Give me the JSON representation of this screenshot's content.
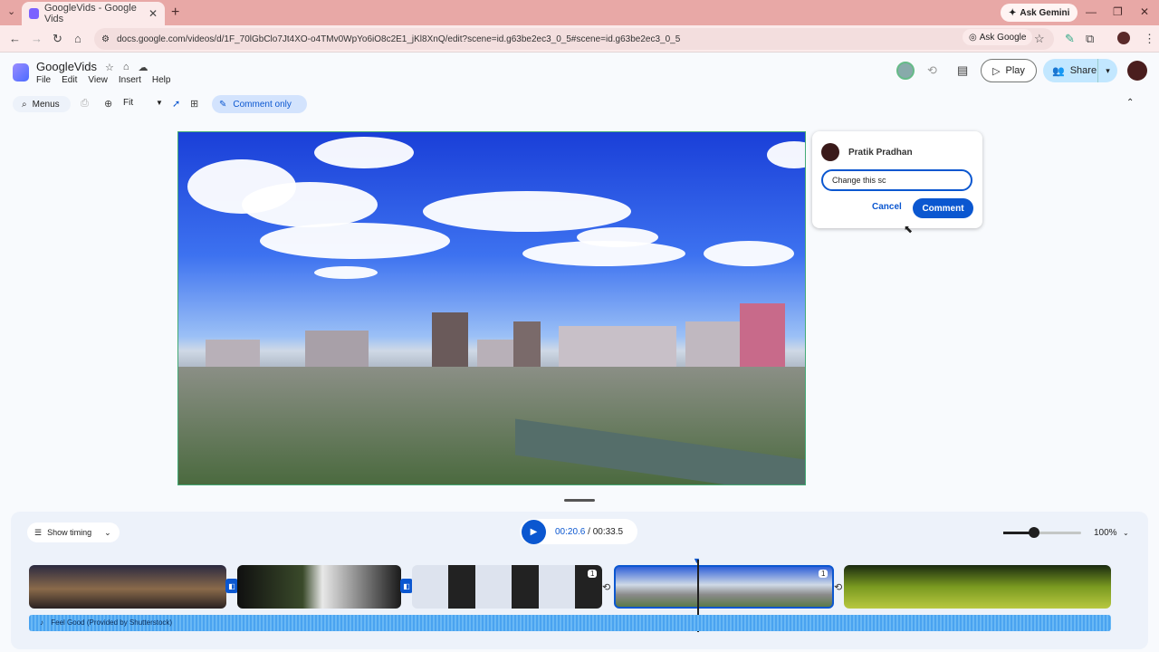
{
  "browser": {
    "tab_title": "GoogleVids - Google Vids",
    "tab_close": "✕",
    "new_tab": "+",
    "ask_gemini": "Ask Gemini",
    "url": "docs.google.com/videos/d/1F_70lGbClo7Jt4XO-o4TMv0WpYo6iO8c2E1_jKl8XnQ/edit?scene=id.g63be2ec3_0_5#scene=id.g63be2ec3_0_5",
    "ask_google": "Ask Google"
  },
  "app": {
    "doc_title": "GoogleVids",
    "menus": [
      "File",
      "Edit",
      "View",
      "Insert",
      "Help"
    ],
    "play_label": "Play",
    "share_label": "Share"
  },
  "toolbar": {
    "menus_label": "Menus",
    "zoom_label": "Fit",
    "mode_label": "Comment only"
  },
  "comment": {
    "author": "Pratik Pradhan",
    "input_value": "Change this sc",
    "cancel_label": "Cancel",
    "submit_label": "Comment"
  },
  "timeline": {
    "show_timing_label": "Show timing",
    "current_time": "00:20.6",
    "separator": " / ",
    "total_time": "00:33.5",
    "zoom_level": "100%",
    "zoom_fraction": 0.4,
    "clip_badge_1": "1",
    "clip_badge_2": "1",
    "audio_label": "Feel Good (Provided by Shutterstock)"
  },
  "colors": {
    "accent": "#0b57d0",
    "share_bg": "#c2e7ff",
    "chrome_tabbar": "#e8a8a6"
  }
}
